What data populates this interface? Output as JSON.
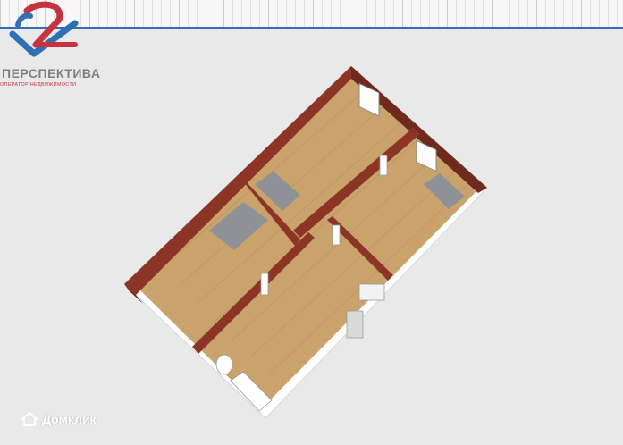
{
  "brand": {
    "name": "ПЕРСПЕКТИВА",
    "tagline": "ОПЕРАТОР НЕДВИЖИМОСТИ",
    "colors": {
      "red": "#c8313e",
      "blue": "#2f6fb6",
      "gray": "#7d7f86"
    }
  },
  "watermark": {
    "text": "Домклик",
    "icon": "house-icon"
  },
  "plan": {
    "colors": {
      "wall": "#8c3526",
      "floor": "#c9a36b",
      "tile": "#8e9196",
      "background": "#e9e9e9"
    }
  }
}
